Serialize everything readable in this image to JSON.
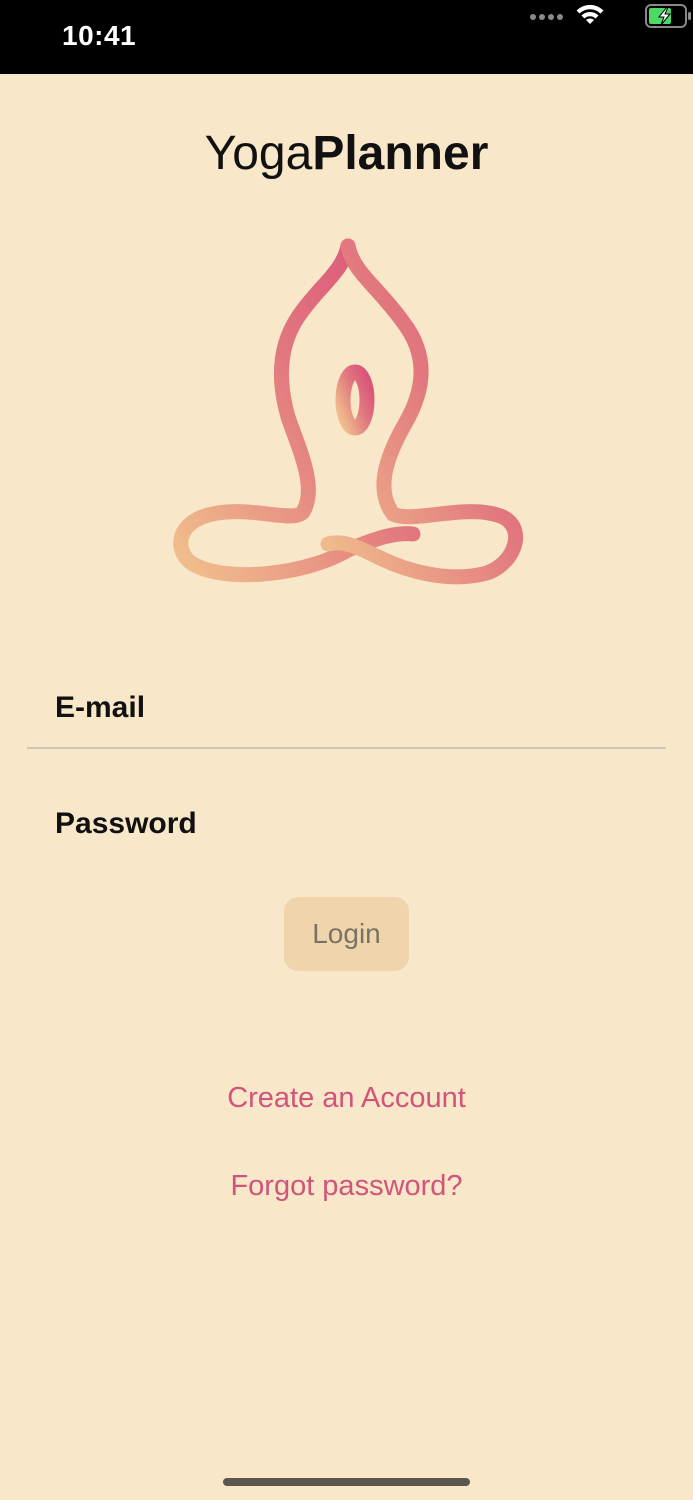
{
  "status_bar": {
    "time": "10:41"
  },
  "app": {
    "title_light": "Yoga",
    "title_bold": "Planner",
    "logo_icon": "yoga-lotus-pose-icon",
    "logo_gradient": [
      "#f1c08c",
      "#d9527a"
    ]
  },
  "form": {
    "email_placeholder": "E-mail",
    "email_value": "",
    "password_placeholder": "Password",
    "password_value": "",
    "login_label": "Login"
  },
  "links": {
    "create_account": "Create an Account",
    "forgot_password": "Forgot password?"
  },
  "colors": {
    "background": "#f8e7c8",
    "accent": "#d1547a",
    "button_bg": "#f0d5ac"
  }
}
